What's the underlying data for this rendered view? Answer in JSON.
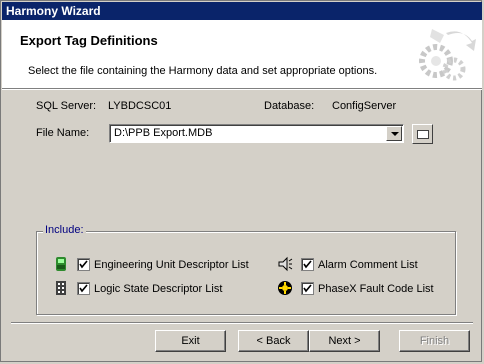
{
  "window": {
    "title": "Harmony Wizard"
  },
  "header": {
    "title": "Export Tag Definitions",
    "subtitle": "Select the file containing the Harmony data and set appropriate options."
  },
  "server": {
    "sql_label": "SQL Server:",
    "sql_value": "LYBDCSC01",
    "db_label": "Database:",
    "db_value": "ConfigServer"
  },
  "file": {
    "label": "File Name:",
    "value": "D:\\PPB Export.MDB"
  },
  "include": {
    "title": "Include:",
    "options": [
      {
        "label": "Engineering Unit Descriptor List",
        "checked": true,
        "icon": "engineering-unit-icon"
      },
      {
        "label": "Alarm Comment List",
        "checked": true,
        "icon": "alarm-comment-icon"
      },
      {
        "label": "Logic State Descriptor List",
        "checked": true,
        "icon": "logic-state-icon"
      },
      {
        "label": "PhaseX Fault Code List",
        "checked": true,
        "icon": "phasex-fault-icon"
      }
    ]
  },
  "buttons": {
    "exit": "Exit",
    "back": "< Back",
    "next": "Next >",
    "finish": "Finish"
  }
}
